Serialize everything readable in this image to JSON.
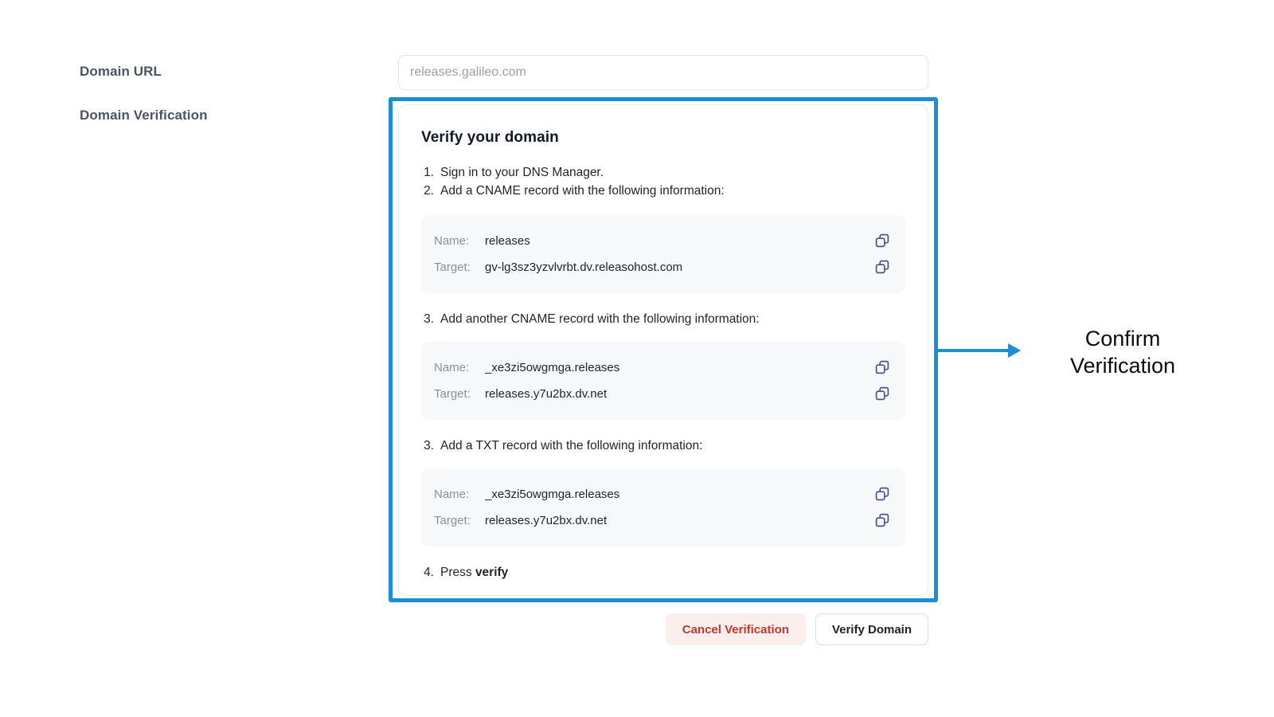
{
  "form": {
    "domain_url_label": "Domain URL",
    "domain_verification_label": "Domain Verification",
    "domain_url_value": "",
    "domain_url_placeholder": "releases.galileo.com"
  },
  "card": {
    "title": "Verify your domain",
    "steps": [
      {
        "num": "1.",
        "text": "Sign in to your DNS Manager."
      },
      {
        "num": "2.",
        "text": "Add a CNAME record with the following information:"
      }
    ],
    "step3_cname": {
      "num": "3.",
      "text": "Add another CNAME record with the following information:"
    },
    "step3_txt": {
      "num": "3.",
      "text": "Add a TXT record with the following information:"
    },
    "step4": {
      "num": "4.",
      "text_prefix": "Press ",
      "text_bold": "verify"
    },
    "record_key_name": "Name:",
    "record_key_target": "Target:",
    "records": [
      {
        "name": "releases",
        "target": "gv-lg3sz3yzvlvrbt.dv.releasohost.com"
      },
      {
        "name": "_xe3zi5owgmga.releases",
        "target": "releases.y7u2bx.dv.net"
      },
      {
        "name": "_xe3zi5owgmga.releases",
        "target": "releases.y7u2bx.dv.net"
      }
    ],
    "copy_icon": "copy-icon"
  },
  "actions": {
    "cancel_label": "Cancel Verification",
    "verify_label": "Verify Domain"
  },
  "annotation": {
    "line1": "Confirm",
    "line2": "Verification",
    "arrow_icon": "arrow-right-icon"
  },
  "colors": {
    "highlight": "#1a8fd4",
    "annotation_arrow": "#1a8fd4",
    "cancel_text": "#c0392b",
    "cancel_bg": "#fdeeee",
    "copy_icon": "#4d5291",
    "record_bg": "#f7f8f9"
  }
}
